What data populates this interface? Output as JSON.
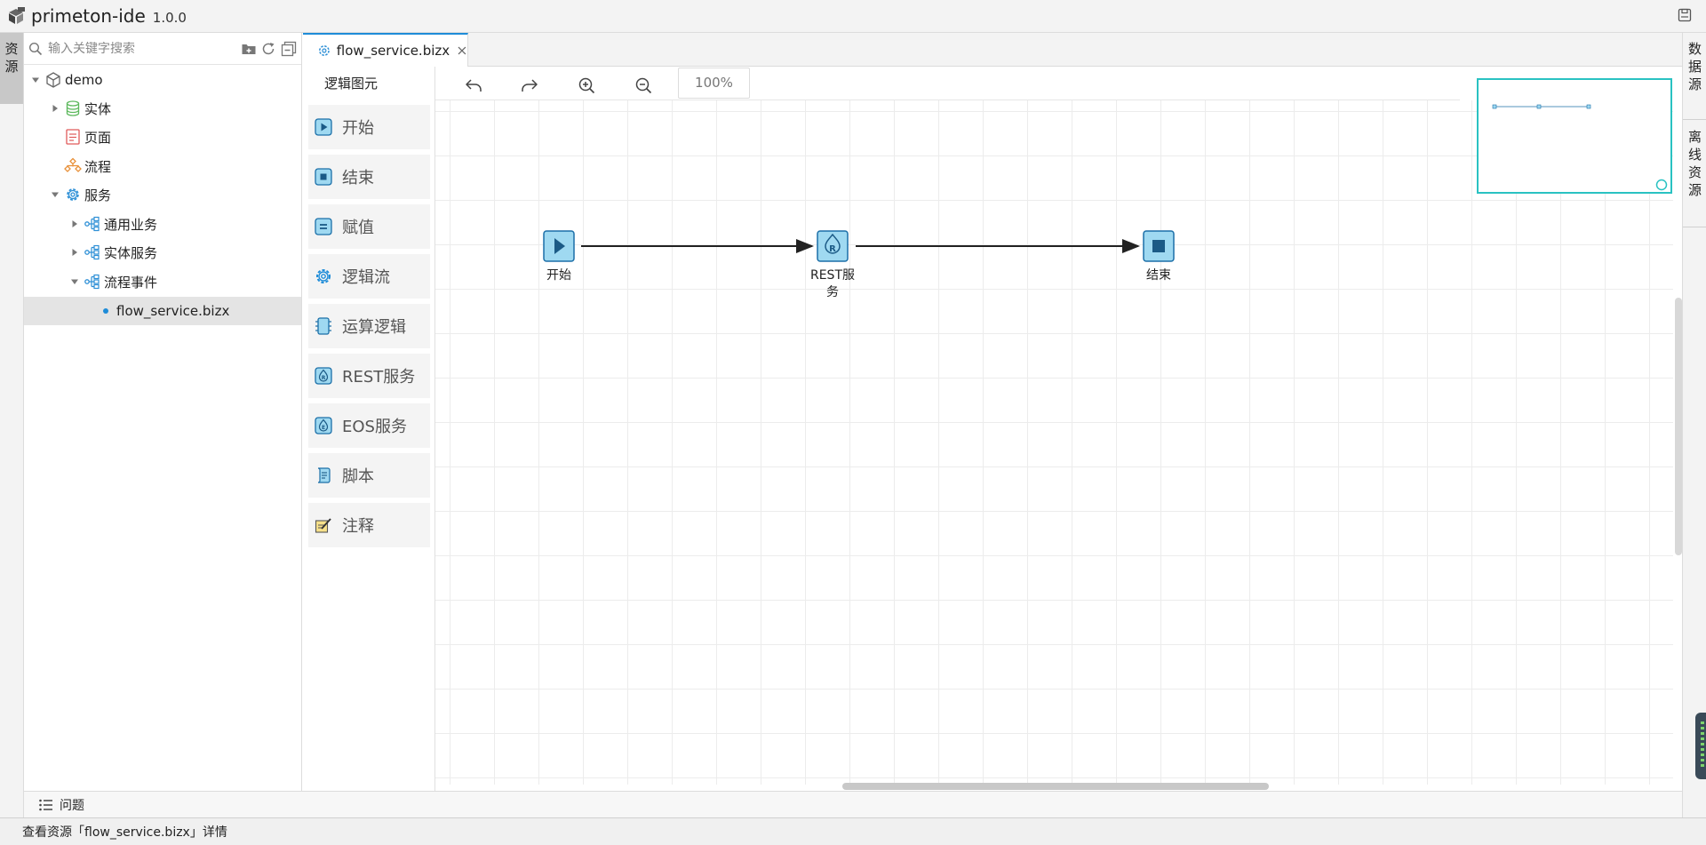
{
  "app": {
    "name": "primeton-ide",
    "version": "1.0.0"
  },
  "left_strip": {
    "resource_tab": "资源"
  },
  "explorer": {
    "search_placeholder": "输入关键字搜索",
    "tree": [
      {
        "label": "demo",
        "icon": "cube-icon"
      },
      {
        "label": "实体",
        "icon": "database-icon"
      },
      {
        "label": "页面",
        "icon": "page-icon"
      },
      {
        "label": "流程",
        "icon": "process-icon"
      },
      {
        "label": "服务",
        "icon": "gear-icon"
      },
      {
        "label": "通用业务",
        "icon": "branch-icon"
      },
      {
        "label": "实体服务",
        "icon": "branch-icon"
      },
      {
        "label": "流程事件",
        "icon": "branch-icon"
      },
      {
        "label": "flow_service.bizx",
        "icon": "dot-icon"
      }
    ]
  },
  "editor": {
    "tab_label": "flow_service.bizx",
    "zoom": "100%"
  },
  "palette": {
    "title": "逻辑图元",
    "items": [
      {
        "label": "开始",
        "icon": "play-icon"
      },
      {
        "label": "结束",
        "icon": "stop-icon"
      },
      {
        "label": "赋值",
        "icon": "assign-icon"
      },
      {
        "label": "逻辑流",
        "icon": "gear-icon"
      },
      {
        "label": "运算逻辑",
        "icon": "chip-icon"
      },
      {
        "label": "REST服务",
        "icon": "rest-icon"
      },
      {
        "label": "EOS服务",
        "icon": "eos-icon"
      },
      {
        "label": "脚本",
        "icon": "script-icon"
      },
      {
        "label": "注释",
        "icon": "note-icon"
      }
    ]
  },
  "flow": {
    "nodes": [
      {
        "label": "开始",
        "type": "start"
      },
      {
        "label": "REST服",
        "label2": "务",
        "type": "rest"
      },
      {
        "label": "结束",
        "type": "end"
      }
    ]
  },
  "right_strip": {
    "datasource_tab": "数据源",
    "offline_tab": "离线资源"
  },
  "problems": {
    "label": "问题"
  },
  "statusbar": {
    "text": "查看资源「flow_service.bizx」详情"
  },
  "colors": {
    "accent": "#1e8cd8",
    "node_fill": "#9fd9f1",
    "node_border": "#1b6fa8",
    "minimap_border": "#29c2c2"
  }
}
